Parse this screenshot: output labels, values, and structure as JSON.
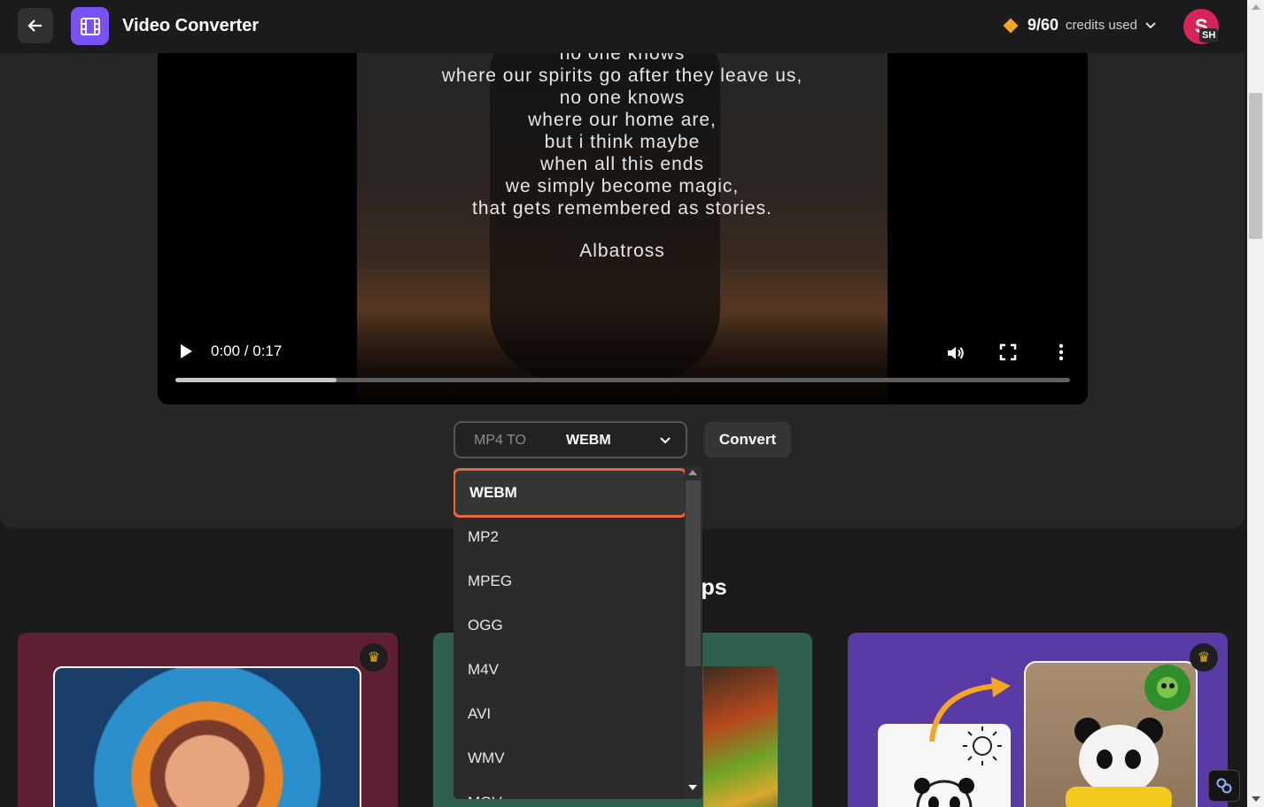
{
  "header": {
    "back_icon": "arrow-left-icon",
    "app_icon": "film-icon",
    "title": "Video Converter",
    "credits_count": "9/60",
    "credits_label": "credits used",
    "avatar_letter": "S",
    "avatar_badge": "SH",
    "colors": {
      "accent": "#7a52f4",
      "avatar": "#d6245b",
      "credit_diamond": "#f5a623"
    }
  },
  "video": {
    "poem_lines": [
      "no one knows",
      "where our spirits go after they leave us,",
      "no one knows",
      "where our home are,",
      "but i think maybe",
      "when all this ends",
      "we simply become magic,",
      "that gets remembered as stories."
    ],
    "author": "Albatross",
    "time": "0:00 / 0:17",
    "progress_buffered": 0.18
  },
  "converter": {
    "from_label": "MP4 TO",
    "to_value": "WEBM",
    "convert_label": "Convert",
    "options": [
      "WEBM",
      "MP2",
      "MPEG",
      "OGG",
      "M4V",
      "AVI",
      "WMV",
      "MOV"
    ],
    "selected": "WEBM",
    "highlight_color": "#e9653a"
  },
  "recent": {
    "title_visible": "ied apps",
    "cards": [
      {
        "theme_color": "#5f1f35",
        "premium": true
      },
      {
        "theme_color": "#2f5f4f",
        "premium": false
      },
      {
        "theme_color": "#5a3ba5",
        "premium": true
      }
    ]
  }
}
